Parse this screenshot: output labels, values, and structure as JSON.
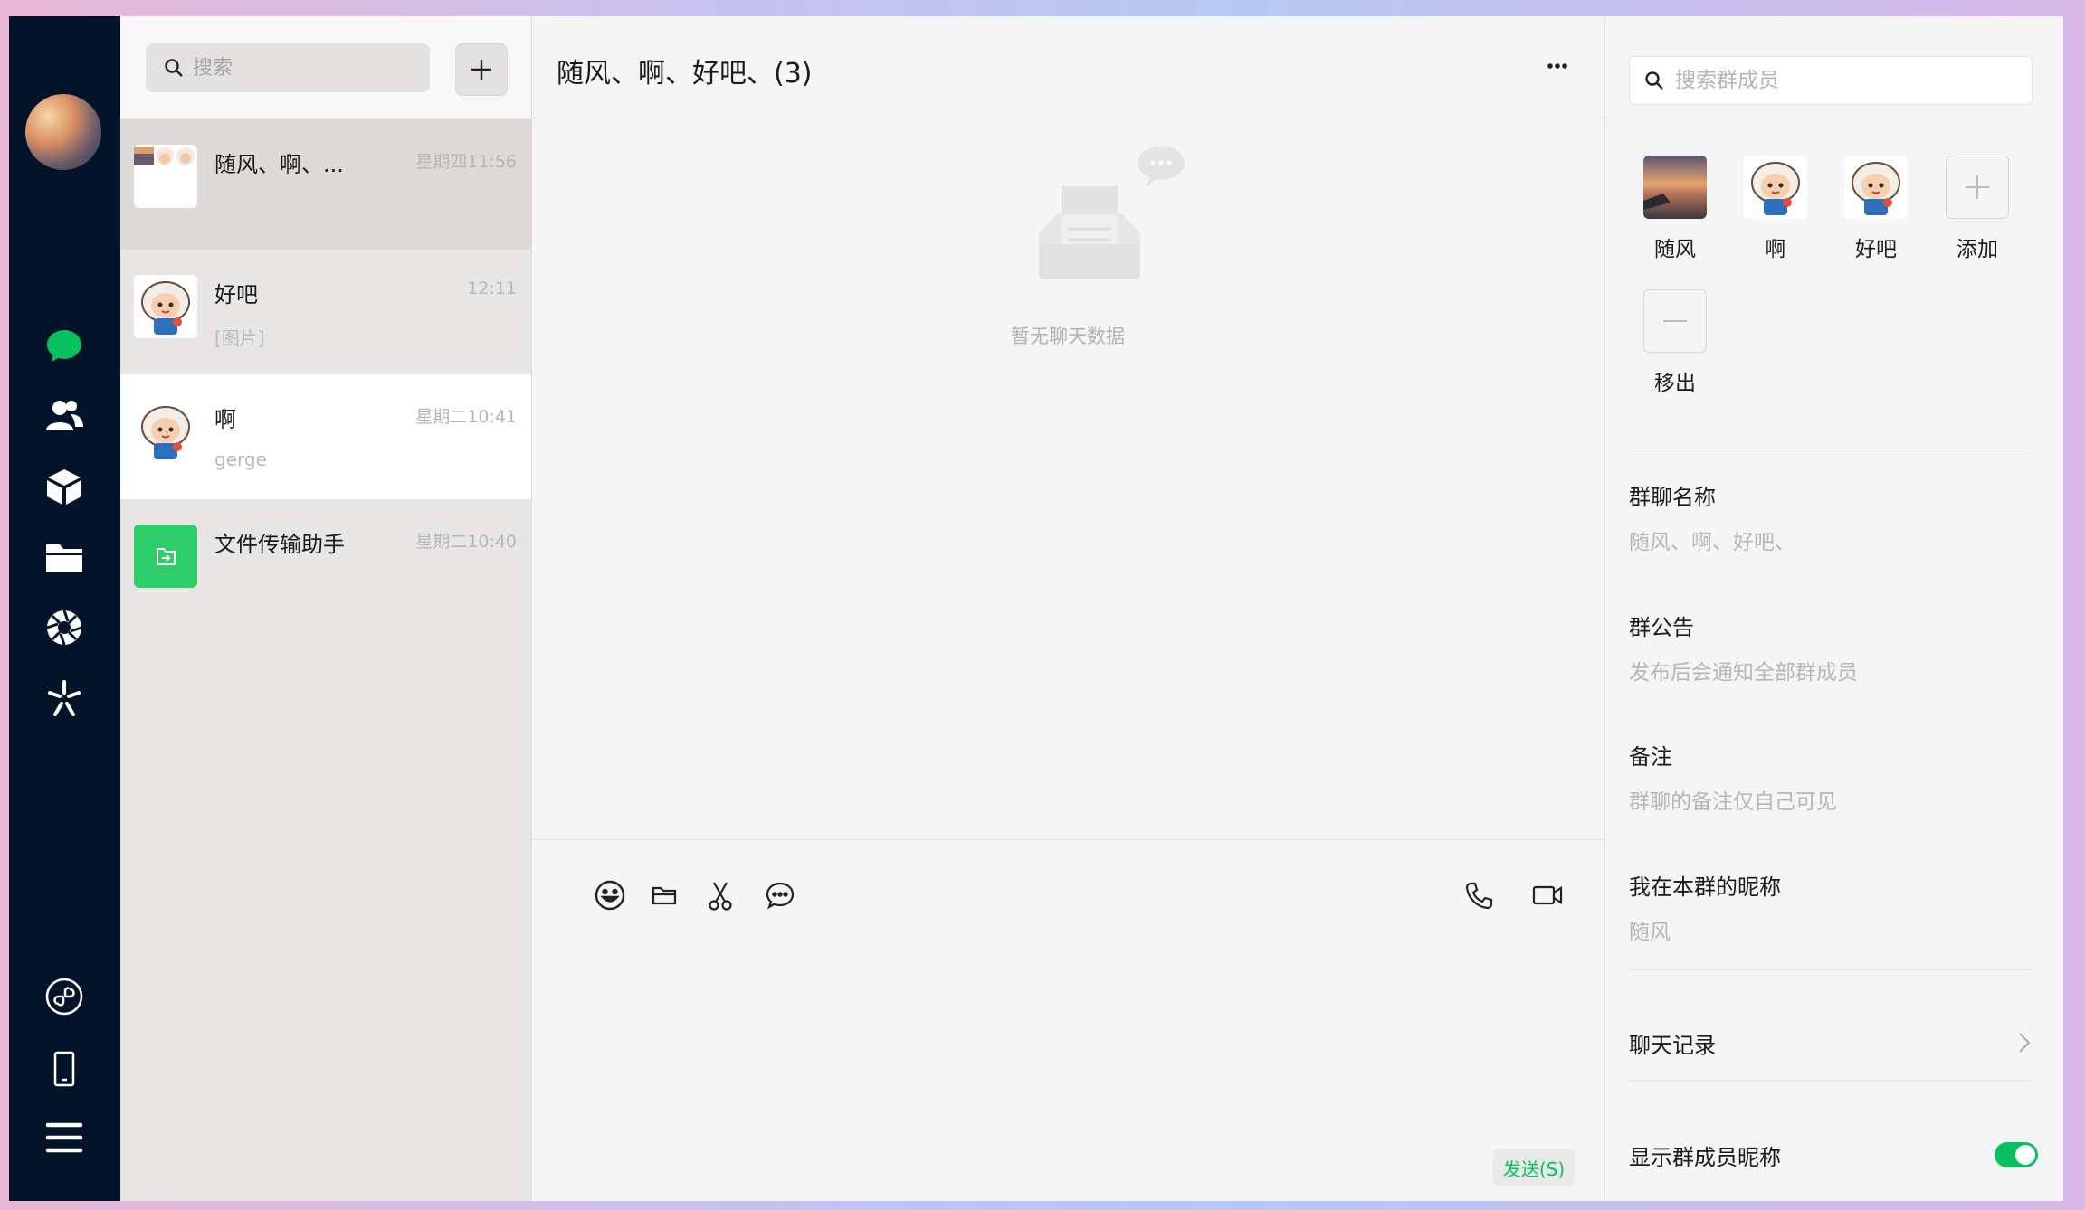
{
  "sidebar": {
    "avatar": "user-avatar",
    "icons": [
      "chat-icon",
      "contacts-icon",
      "box-icon",
      "folder-icon",
      "moments-icon",
      "discover-icon",
      "mini-program-icon",
      "phone-icon",
      "menu-icon"
    ],
    "active_color": "#07c160"
  },
  "list": {
    "search_placeholder": "搜索",
    "add_label": "+",
    "chats": [
      {
        "name": "随风、啊、...",
        "time": "星期四11:56",
        "preview": "",
        "avatar": "group-avatar"
      },
      {
        "name": "好吧",
        "time": "12:11",
        "preview": "[图片]",
        "avatar": "mascot-avatar"
      },
      {
        "name": "啊",
        "time": "星期二10:41",
        "preview": "gerge",
        "avatar": "mascot-avatar"
      },
      {
        "name": "文件传输助手",
        "time": "星期二10:40",
        "preview": "",
        "avatar": "file-transfer-icon"
      }
    ]
  },
  "chat": {
    "title": "随风、啊、好吧、(3)",
    "empty_text": "暂无聊天数据",
    "send_label": "发送(S)",
    "tools": [
      "emoji-icon",
      "folder-icon",
      "scissors-icon",
      "chat-bubble-icon",
      "phone-call-icon",
      "video-call-icon"
    ]
  },
  "info": {
    "search_placeholder": "搜索群成员",
    "members": [
      {
        "name": "随风",
        "avatar": "sunset-avatar"
      },
      {
        "name": "啊",
        "avatar": "mascot-avatar"
      },
      {
        "name": "好吧",
        "avatar": "mascot-avatar"
      },
      {
        "name": "添加",
        "avatar": "plus-icon"
      },
      {
        "name": "移出",
        "avatar": "minus-icon"
      }
    ],
    "group_name_label": "群聊名称",
    "group_name_value": "随风、啊、好吧、",
    "notice_label": "群公告",
    "notice_value": "发布后会通知全部群成员",
    "remark_label": "备注",
    "remark_value": "群聊的备注仅自己可见",
    "nickname_label": "我在本群的昵称",
    "nickname_value": "随风",
    "history_label": "聊天记录",
    "show_nickname_label": "显示群成员昵称",
    "show_nickname_on": true
  }
}
